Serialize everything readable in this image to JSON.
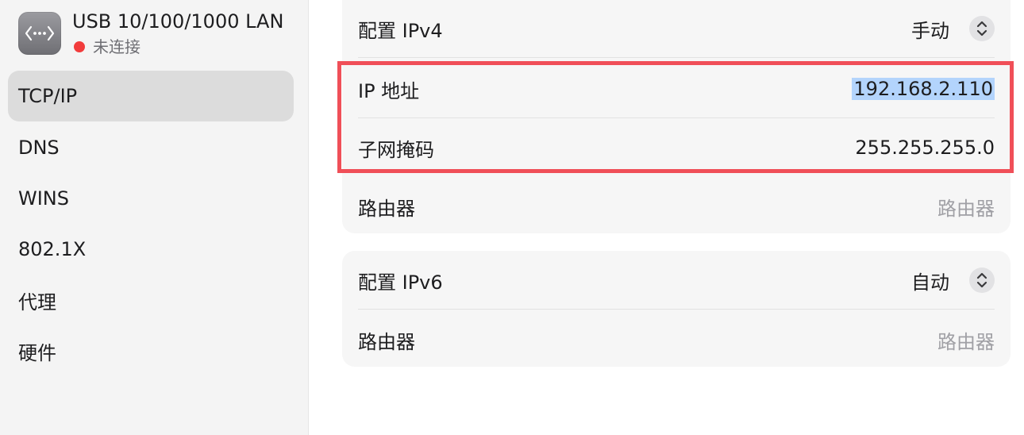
{
  "interface": {
    "icon": "ethernet-arrows-icon",
    "name": "USB 10/100/1000 LAN",
    "status_text": "未连接",
    "status_color": "#f23c3c"
  },
  "sidebar": {
    "items": [
      {
        "label": "TCP/IP",
        "selected": true
      },
      {
        "label": "DNS",
        "selected": false
      },
      {
        "label": "WINS",
        "selected": false
      },
      {
        "label": "802.1X",
        "selected": false
      },
      {
        "label": "代理",
        "selected": false
      },
      {
        "label": "硬件",
        "selected": false
      }
    ]
  },
  "ipv4": {
    "configure_label": "配置 IPv4",
    "configure_value": "手动",
    "ip_label": "IP 地址",
    "ip_value": "192.168.2.110",
    "subnet_label": "子网掩码",
    "subnet_value": "255.255.255.0",
    "router_label": "路由器",
    "router_placeholder": "路由器"
  },
  "ipv6": {
    "configure_label": "配置 IPv6",
    "configure_value": "自动",
    "router_label": "路由器",
    "router_placeholder": "路由器"
  },
  "colors": {
    "highlight_border": "#f04f58",
    "text_selection": "#b3d4fc",
    "sidebar_selected": "#dcdcdc"
  }
}
